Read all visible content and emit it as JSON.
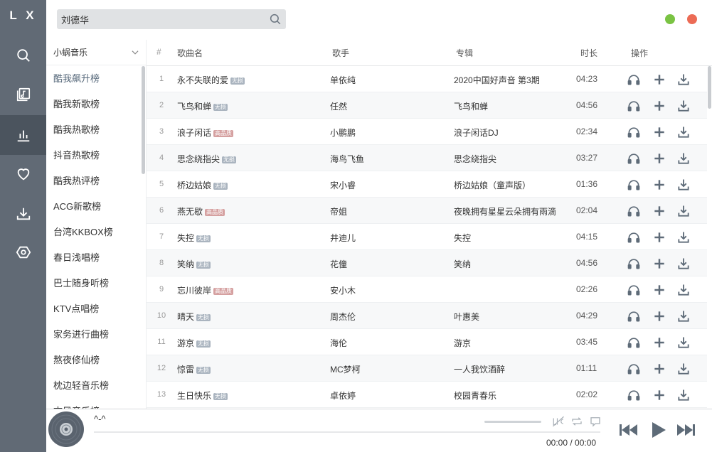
{
  "app": {
    "logo": "L X"
  },
  "search": {
    "value": "刘德华"
  },
  "source": {
    "selected": "小蜗音乐"
  },
  "boards": [
    {
      "label": "酷我飙升榜",
      "active": true
    },
    {
      "label": "酷我新歌榜",
      "active": false
    },
    {
      "label": "酷我热歌榜",
      "active": false
    },
    {
      "label": "抖音热歌榜",
      "active": false
    },
    {
      "label": "酷我热评榜",
      "active": false
    },
    {
      "label": "ACG新歌榜",
      "active": false
    },
    {
      "label": "台湾KKBOX榜",
      "active": false
    },
    {
      "label": "春日浅唱榜",
      "active": false
    },
    {
      "label": "巴士随身听榜",
      "active": false
    },
    {
      "label": "KTV点唱榜",
      "active": false
    },
    {
      "label": "家务进行曲榜",
      "active": false
    },
    {
      "label": "熬夜修仙榜",
      "active": false
    },
    {
      "label": "枕边轻音乐榜",
      "active": false
    },
    {
      "label": "古风音乐榜",
      "active": false
    }
  ],
  "table": {
    "headers": {
      "num": "#",
      "name": "歌曲名",
      "singer": "歌手",
      "album": "专辑",
      "duration": "时长",
      "ops": "操作"
    },
    "rows": [
      {
        "num": "1",
        "name": "永不失联的爱",
        "tag": "无损",
        "tag_type": "lossless",
        "singer": "单依纯",
        "album": "2020中国好声音 第3期",
        "duration": "04:23"
      },
      {
        "num": "2",
        "name": "飞鸟和蝉",
        "tag": "无损",
        "tag_type": "lossless",
        "singer": "任然",
        "album": "飞鸟和蝉",
        "duration": "04:56"
      },
      {
        "num": "3",
        "name": "浪子闲话",
        "tag": "高品质",
        "tag_type": "hq",
        "singer": "小鹏鹏",
        "album": "浪子闲话DJ",
        "duration": "02:34"
      },
      {
        "num": "4",
        "name": "思念绕指尖",
        "tag": "无损",
        "tag_type": "lossless",
        "singer": "海鸟飞鱼",
        "album": "思念绕指尖",
        "duration": "03:27"
      },
      {
        "num": "5",
        "name": "桥边姑娘",
        "tag": "无损",
        "tag_type": "lossless",
        "singer": "宋小睿",
        "album": "桥边姑娘（童声版）",
        "duration": "01:36"
      },
      {
        "num": "6",
        "name": "燕无歇",
        "tag": "高品质",
        "tag_type": "hq",
        "singer": "帝姐",
        "album": "夜晚拥有星星云朵拥有雨滴",
        "duration": "02:04"
      },
      {
        "num": "7",
        "name": "失控",
        "tag": "无损",
        "tag_type": "lossless",
        "singer": "井迪儿",
        "album": "失控",
        "duration": "04:15"
      },
      {
        "num": "8",
        "name": "笑纳",
        "tag": "无损",
        "tag_type": "lossless",
        "singer": "花僮",
        "album": "笑纳",
        "duration": "04:56"
      },
      {
        "num": "9",
        "name": "忘川彼岸",
        "tag": "高品质",
        "tag_type": "hq",
        "singer": "安小木",
        "album": "",
        "duration": "02:26"
      },
      {
        "num": "10",
        "name": "晴天",
        "tag": "无损",
        "tag_type": "lossless",
        "singer": "周杰伦",
        "album": "叶惠美",
        "duration": "04:29"
      },
      {
        "num": "11",
        "name": "游京",
        "tag": "无损",
        "tag_type": "lossless",
        "singer": "海伦",
        "album": "游京",
        "duration": "03:45"
      },
      {
        "num": "12",
        "name": "惊雷",
        "tag": "无损",
        "tag_type": "lossless",
        "singer": "MC梦柯",
        "album": "一人我饮酒醉",
        "duration": "01:11"
      },
      {
        "num": "13",
        "name": "生日快乐",
        "tag": "无损",
        "tag_type": "lossless",
        "singer": "卓依婷",
        "album": "校园青春乐",
        "duration": "02:02"
      }
    ]
  },
  "player": {
    "title": "^-^",
    "time": "00:00 / 00:00",
    "progress": 0
  },
  "colors": {
    "nav_bg": "#616a75",
    "nav_active": "#4b545e",
    "min_button": "#7ac343",
    "close_button": "#ec6b55",
    "tag_lossless": "#aab4bf",
    "tag_hq": "#d5a0a0",
    "icon": "#5e6b78"
  },
  "icons": {
    "nav": [
      "search-icon",
      "music-library-icon",
      "chart-icon",
      "heart-icon",
      "download-icon",
      "settings-icon"
    ],
    "ops": [
      "headphones-icon",
      "plus-icon",
      "download-icon"
    ],
    "player": [
      "lyrics-icon",
      "repeat-icon",
      "comment-icon",
      "previous-icon",
      "play-icon",
      "next-icon"
    ]
  }
}
